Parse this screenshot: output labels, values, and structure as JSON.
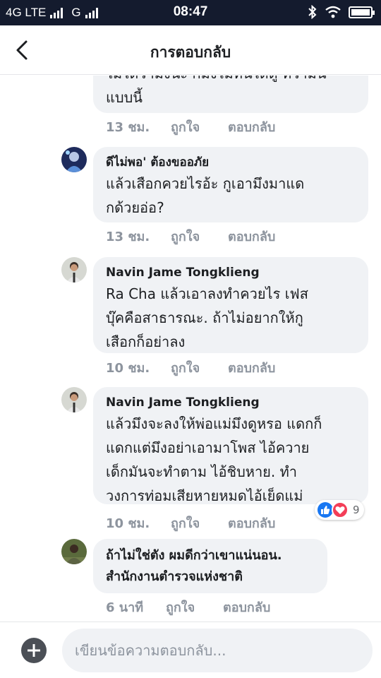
{
  "status_bar": {
    "network_left": "4G LTE",
    "network_right": "G",
    "time": "08:47"
  },
  "header": {
    "title": "การตอบกลับ"
  },
  "actions": {
    "like": "ถูกใจ",
    "reply": "ตอบกลับ"
  },
  "comments": [
    {
      "author": "",
      "lines": [
        "ไม่ได้ว่ามึงนะ ก็มึงไม่ทันได้ดู ที่ว่ามัน",
        "แบบนี้"
      ],
      "time": "13 ชม."
    },
    {
      "author": "ดีไม่พอ' ต้องขออภัย",
      "lines": [
        "แล้วเสือกควยไรอ้ะ กูเอามึงมาแด",
        "กด้วยอ่อ?"
      ],
      "time": "13 ชม."
    },
    {
      "author": "Navin Jame Tongklieng",
      "lines": [
        "Ra Cha แล้วเอาลงทำควยไร  เฟส",
        "บุ๊คคือสาธารณะ. ถ้าไม่อยากให้กู",
        "เสือกก็อย่าลง"
      ],
      "time": "10 ชม."
    },
    {
      "author": "Navin Jame Tongklieng",
      "lines": [
        "แล้วมึงจะลงให้พ่อแม่มึงดูหรอ แดกก็",
        "แดกแต่มึงอย่าเอามาโพส ไอ้ควาย",
        "เด็กมันจะทำตาม  ไอ้ชิบหาย. ทำ",
        "วงการท่อมเสียหายหมดไอ้เย็ดแม่"
      ],
      "time": "10 ชม.",
      "reaction_count": "9"
    },
    {
      "author": "",
      "lines": [
        "ถ้าไม่ใช่ตัง ผมดีกว่าเขาแน่นอน.",
        "สำนักงานตำรวจแห่งชาติ"
      ],
      "time": "6 นาที"
    }
  ],
  "composer": {
    "placeholder": "เขียนข้อความตอบกลับ..."
  }
}
